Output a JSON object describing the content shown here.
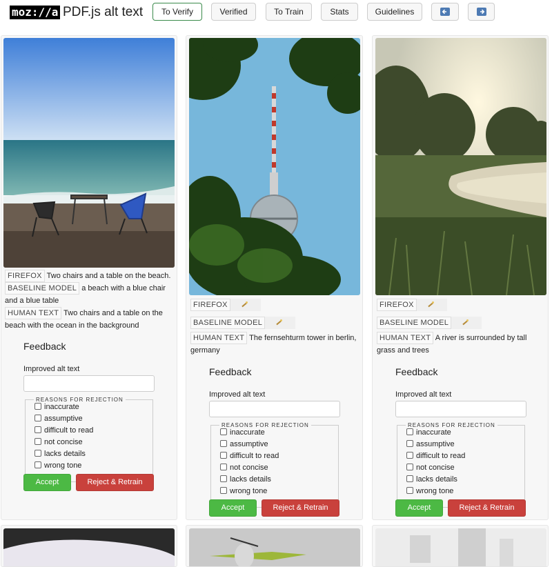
{
  "header": {
    "logo": "moz://a",
    "title": "PDF.js alt text",
    "nav": [
      "To Verify",
      "Verified",
      "To Train",
      "Stats",
      "Guidelines"
    ],
    "prev_icon": "arrow-left-icon",
    "next_icon": "arrow-right-icon"
  },
  "labels": {
    "firefox": "FIREFOX",
    "baseline": "BASELINE MODEL",
    "human": "HUMAN TEXT",
    "feedback": "Feedback",
    "improved": "Improved alt text",
    "reasons_legend": "REASONS FOR REJECTION",
    "reasons": [
      "inaccurate",
      "assumptive",
      "difficult to read",
      "not concise",
      "lacks details",
      "wrong tone"
    ],
    "accept": "Accept",
    "reject": "Reject & Retrain"
  },
  "cards": [
    {
      "firefox": "Two chairs and a table on the beach.",
      "baseline": "a beach with a blue chair and a blue table",
      "human": "Two chairs and a table on the beach with the ocean in the background"
    },
    {
      "firefox": "",
      "baseline": "",
      "human": "The fernsehturm tower in berlin, germany"
    },
    {
      "firefox": "",
      "baseline": "",
      "human": "A river is surrounded by tall grass and trees"
    }
  ],
  "colors": {
    "accept": "#4cb944",
    "reject": "#c9413c",
    "active_nav_border": "#3a8a4a"
  }
}
